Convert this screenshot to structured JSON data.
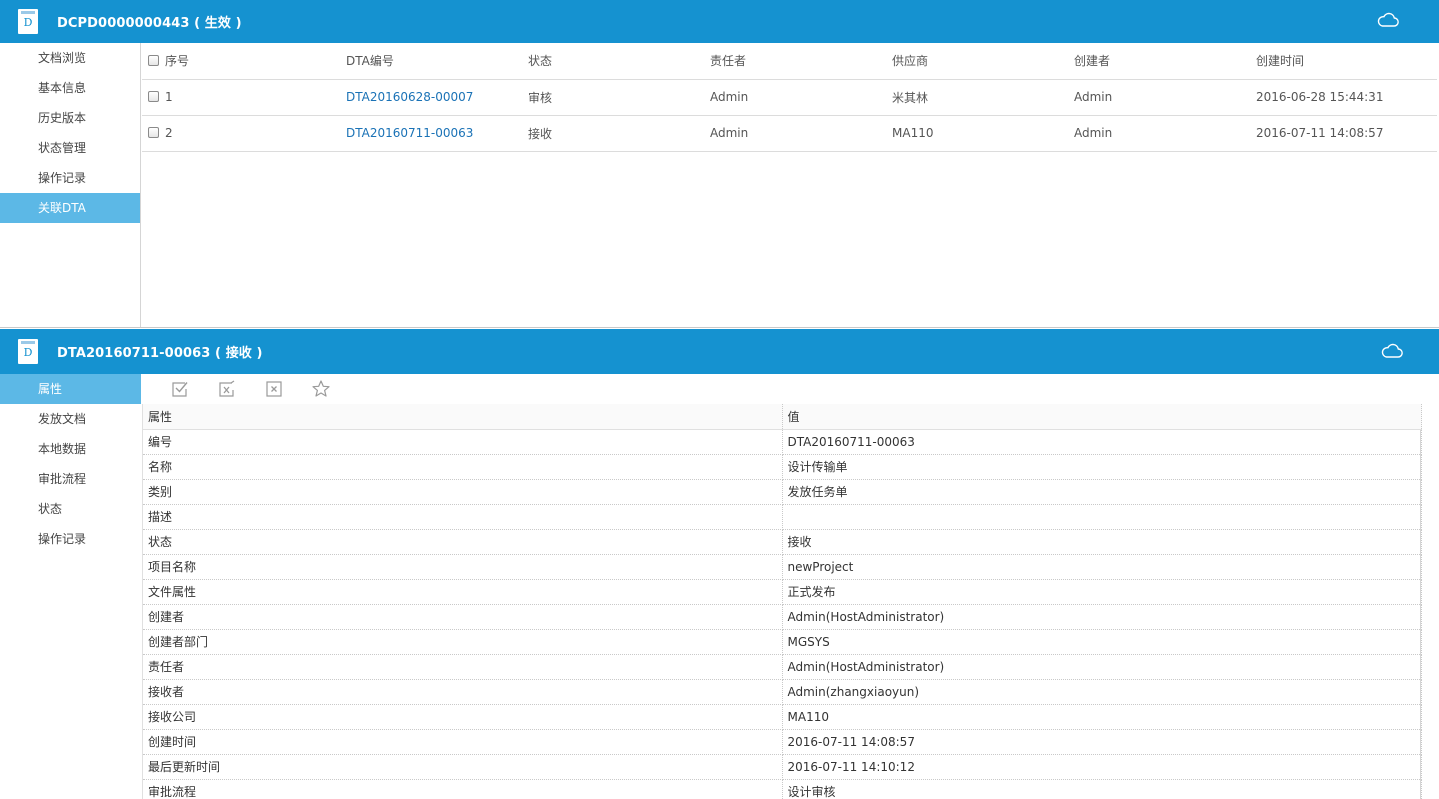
{
  "top": {
    "title": "DCPD0000000443 ( 生效 )",
    "icon_letter": "D",
    "sidebar": [
      {
        "label": "文档浏览",
        "active": false
      },
      {
        "label": "基本信息",
        "active": false
      },
      {
        "label": "历史版本",
        "active": false
      },
      {
        "label": "状态管理",
        "active": false
      },
      {
        "label": "操作记录",
        "active": false
      },
      {
        "label": "关联DTA",
        "active": true
      }
    ],
    "table": {
      "headers": [
        "序号",
        "DTA编号",
        "状态",
        "责任者",
        "供应商",
        "创建者",
        "创建时间"
      ],
      "rows": [
        {
          "seq": "1",
          "dta": "DTA20160628-00007",
          "status": "审核",
          "owner": "Admin",
          "vendor": "米其林",
          "creator": "Admin",
          "created": "2016-06-28 15:44:31"
        },
        {
          "seq": "2",
          "dta": "DTA20160711-00063",
          "status": "接收",
          "owner": "Admin",
          "vendor": "MA110",
          "creator": "Admin",
          "created": "2016-07-11 14:08:57"
        }
      ]
    }
  },
  "bottom": {
    "title": "DTA20160711-00063 ( 接收 )",
    "icon_letter": "D",
    "sidebar": [
      {
        "label": "属性",
        "active": true
      },
      {
        "label": "发放文档",
        "active": false
      },
      {
        "label": "本地数据",
        "active": false
      },
      {
        "label": "审批流程",
        "active": false
      },
      {
        "label": "状态",
        "active": false
      },
      {
        "label": "操作记录",
        "active": false
      }
    ],
    "props": {
      "header_key": "属性",
      "header_value": "值",
      "rows": [
        {
          "k": "编号",
          "v": "DTA20160711-00063"
        },
        {
          "k": "名称",
          "v": "设计传输单"
        },
        {
          "k": "类别",
          "v": "发放任务单"
        },
        {
          "k": "描述",
          "v": ""
        },
        {
          "k": "状态",
          "v": "接收"
        },
        {
          "k": "项目名称",
          "v": "newProject"
        },
        {
          "k": "文件属性",
          "v": "正式发布"
        },
        {
          "k": "创建者",
          "v": "Admin(HostAdministrator)"
        },
        {
          "k": "创建者部门",
          "v": "MGSYS"
        },
        {
          "k": "责任者",
          "v": "Admin(HostAdministrator)"
        },
        {
          "k": "接收者",
          "v": "Admin(zhangxiaoyun)"
        },
        {
          "k": "接收公司",
          "v": "MA110"
        },
        {
          "k": "创建时间",
          "v": "2016-07-11 14:08:57"
        },
        {
          "k": "最后更新时间",
          "v": "2016-07-11 14:10:12"
        },
        {
          "k": "审批流程",
          "v": "设计审核"
        }
      ]
    }
  },
  "colors": {
    "header_bg": "#1592d0",
    "active_bg": "#5cb8e6",
    "link": "#1a72b6"
  }
}
